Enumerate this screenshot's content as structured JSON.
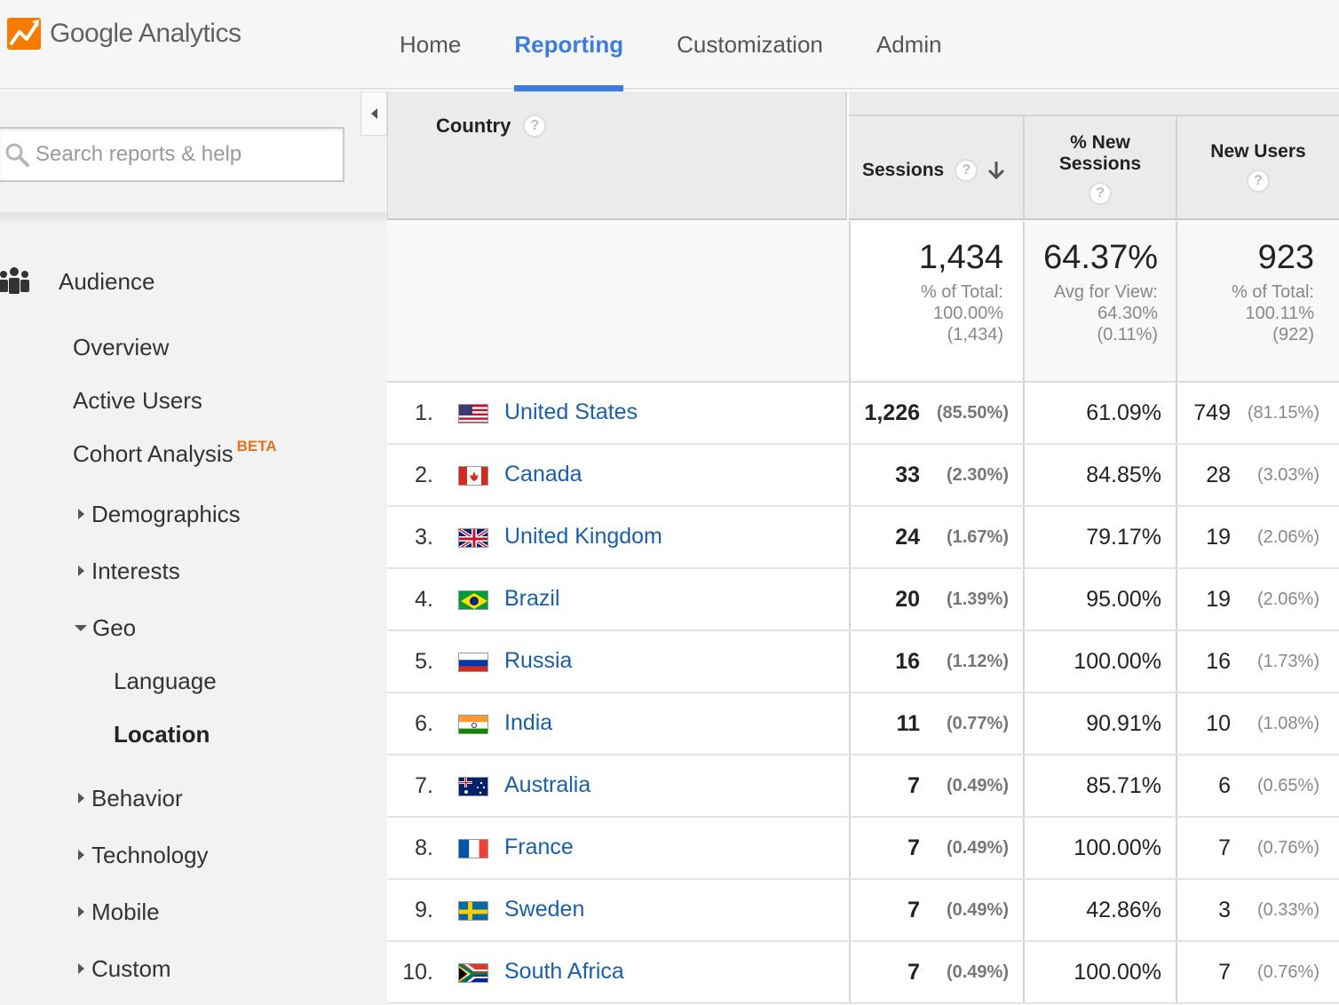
{
  "app": {
    "brand": "Google Analytics"
  },
  "nav": {
    "items": [
      {
        "label": "Home",
        "active": false
      },
      {
        "label": "Reporting",
        "active": true
      },
      {
        "label": "Customization",
        "active": false
      },
      {
        "label": "Admin",
        "active": false
      }
    ]
  },
  "sidebar": {
    "search_placeholder": "Search reports & help",
    "section_label": "Audience",
    "items": [
      {
        "label": "Overview"
      },
      {
        "label": "Active Users"
      },
      {
        "label": "Cohort Analysis",
        "badge": "BETA"
      },
      {
        "label": "Demographics"
      },
      {
        "label": "Interests"
      },
      {
        "label": "Geo"
      },
      {
        "label": "Language"
      },
      {
        "label": "Location"
      },
      {
        "label": "Behavior"
      },
      {
        "label": "Technology"
      },
      {
        "label": "Mobile"
      },
      {
        "label": "Custom"
      }
    ]
  },
  "table": {
    "headers": {
      "country": "Country",
      "sessions": "Sessions",
      "new_sessions_line1": "% New",
      "new_sessions_line2": "Sessions",
      "new_users": "New Users",
      "help": "?"
    },
    "summary": {
      "sessions": {
        "value": "1,434",
        "line1": "% of Total:",
        "line2": "100.00%",
        "line3": "(1,434)"
      },
      "new_sessions": {
        "value": "64.37%",
        "line1": "Avg for View:",
        "line2": "64.30%",
        "line3": "(0.11%)"
      },
      "new_users": {
        "value": "923",
        "line1": "% of Total:",
        "line2": "100.11%",
        "line3": "(922)"
      }
    },
    "rows": [
      {
        "idx": "1.",
        "country": "United States",
        "flag": "us-flag",
        "sessions": "1,226",
        "sessions_pct": "(85.50%)",
        "new_sessions": "61.09%",
        "new_users": "749",
        "new_users_pct": "(81.15%)"
      },
      {
        "idx": "2.",
        "country": "Canada",
        "flag": "ca-flag",
        "sessions": "33",
        "sessions_pct": "(2.30%)",
        "new_sessions": "84.85%",
        "new_users": "28",
        "new_users_pct": "(3.03%)"
      },
      {
        "idx": "3.",
        "country": "United Kingdom",
        "flag": "gb-flag",
        "sessions": "24",
        "sessions_pct": "(1.67%)",
        "new_sessions": "79.17%",
        "new_users": "19",
        "new_users_pct": "(2.06%)"
      },
      {
        "idx": "4.",
        "country": "Brazil",
        "flag": "br-flag",
        "sessions": "20",
        "sessions_pct": "(1.39%)",
        "new_sessions": "95.00%",
        "new_users": "19",
        "new_users_pct": "(2.06%)"
      },
      {
        "idx": "5.",
        "country": "Russia",
        "flag": "ru-flag",
        "sessions": "16",
        "sessions_pct": "(1.12%)",
        "new_sessions": "100.00%",
        "new_users": "16",
        "new_users_pct": "(1.73%)"
      },
      {
        "idx": "6.",
        "country": "India",
        "flag": "in-flag",
        "sessions": "11",
        "sessions_pct": "(0.77%)",
        "new_sessions": "90.91%",
        "new_users": "10",
        "new_users_pct": "(1.08%)"
      },
      {
        "idx": "7.",
        "country": "Australia",
        "flag": "au-flag",
        "sessions": "7",
        "sessions_pct": "(0.49%)",
        "new_sessions": "85.71%",
        "new_users": "6",
        "new_users_pct": "(0.65%)"
      },
      {
        "idx": "8.",
        "country": "France",
        "flag": "fr-flag",
        "sessions": "7",
        "sessions_pct": "(0.49%)",
        "new_sessions": "100.00%",
        "new_users": "7",
        "new_users_pct": "(0.76%)"
      },
      {
        "idx": "9.",
        "country": "Sweden",
        "flag": "se-flag",
        "sessions": "7",
        "sessions_pct": "(0.49%)",
        "new_sessions": "42.86%",
        "new_users": "3",
        "new_users_pct": "(0.33%)"
      },
      {
        "idx": "10.",
        "country": "South Africa",
        "flag": "za-flag",
        "sessions": "7",
        "sessions_pct": "(0.49%)",
        "new_sessions": "100.00%",
        "new_users": "7",
        "new_users_pct": "(0.76%)"
      }
    ]
  },
  "colors": {
    "accent": "#3b7ddd",
    "link": "#1a5fa8",
    "beta": "#e8711c",
    "logo_orange": "#f57c00"
  }
}
